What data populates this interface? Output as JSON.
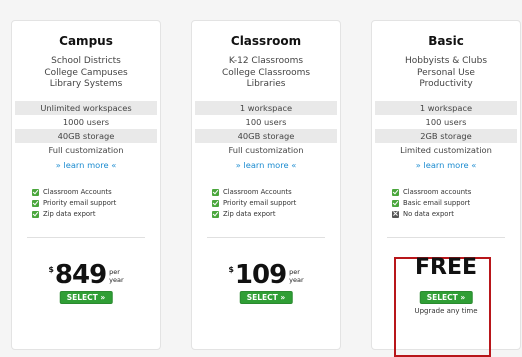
{
  "plans": [
    {
      "name": "Campus",
      "description": [
        "School Districts",
        "College Campuses",
        "Library Systems"
      ],
      "features": [
        "Unlimited workspaces",
        "1000 users",
        "40GB storage",
        "Full customization"
      ],
      "learn_more": "» learn more «",
      "checks": [
        {
          "label": "Classroom Accounts",
          "status": "yes"
        },
        {
          "label": "Priority email support",
          "status": "yes"
        },
        {
          "label": "Zip data export",
          "status": "yes"
        }
      ],
      "price": {
        "currency": "$",
        "amount": "849",
        "per": "per",
        "period": "year"
      },
      "select_label": "SELECT »"
    },
    {
      "name": "Classroom",
      "description": [
        "K-12 Classrooms",
        "College Classrooms",
        "Libraries"
      ],
      "features": [
        "1 workspace",
        "100 users",
        "40GB storage",
        "Full customization"
      ],
      "learn_more": "» learn more «",
      "checks": [
        {
          "label": "Classroom Accounts",
          "status": "yes"
        },
        {
          "label": "Priority email support",
          "status": "yes"
        },
        {
          "label": "Zip data export",
          "status": "yes"
        }
      ],
      "price": {
        "currency": "$",
        "amount": "109",
        "per": "per",
        "period": "year"
      },
      "select_label": "SELECT »"
    },
    {
      "name": "Basic",
      "description": [
        "Hobbyists & Clubs",
        "Personal Use",
        "Productivity"
      ],
      "features": [
        "1 workspace",
        "100 users",
        "2GB storage",
        "Limited customization"
      ],
      "learn_more": "» learn more «",
      "checks": [
        {
          "label": "Classroom accounts",
          "status": "yes"
        },
        {
          "label": "Basic email support",
          "status": "yes"
        },
        {
          "label": "No data export",
          "status": "no"
        }
      ],
      "price_text": "FREE",
      "select_label": "SELECT »",
      "note": "Upgrade any time"
    }
  ],
  "colors": {
    "select_button": "#2f9e35",
    "link": "#1a8bd0",
    "highlight_border": "#b8161a",
    "check_ok": "#4aa63c"
  }
}
